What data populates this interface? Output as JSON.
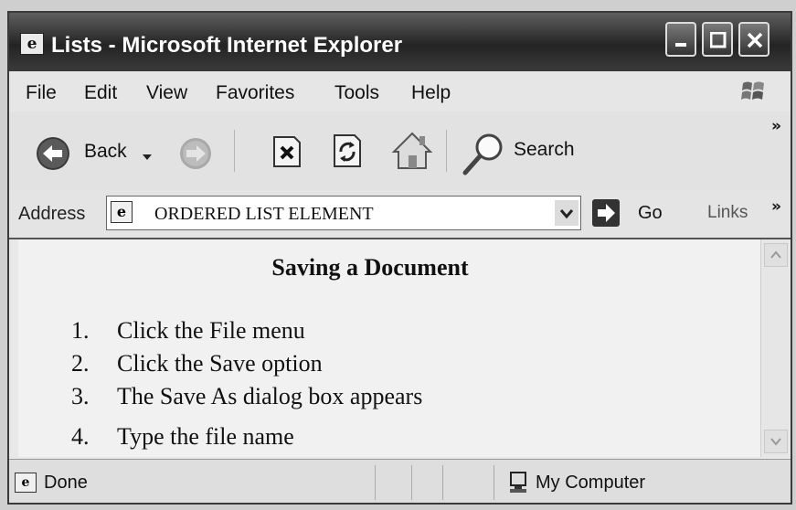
{
  "window": {
    "title": "Lists - Microsoft Internet Explorer"
  },
  "menu": {
    "items": [
      "File",
      "Edit",
      "View",
      "Favorites",
      "Tools",
      "Help"
    ]
  },
  "toolbar": {
    "back_label": "Back",
    "search_label": "Search",
    "overflow": "»"
  },
  "address": {
    "label": "Address",
    "value": "ORDERED LIST ELEMENT",
    "go_label": "Go",
    "links_label": "Links",
    "overflow": "»"
  },
  "document": {
    "heading": "Saving a Document",
    "list_items": [
      {
        "number": "1.",
        "text": "Click the File menu"
      },
      {
        "number": "2.",
        "text": "Click the Save option"
      },
      {
        "number": "3.",
        "text": "The Save As dialog box appears"
      },
      {
        "number": "4.",
        "text": "Type the file name"
      }
    ]
  },
  "status": {
    "text": "Done",
    "zone": "My Computer"
  },
  "colors": {
    "titlebar": "#2b2b2b",
    "content_bg": "#f1f1f1"
  },
  "icons": [
    "ie-page-icon",
    "minimize-icon",
    "maximize-icon",
    "close-icon",
    "windows-logo-icon",
    "back-arrow-icon",
    "forward-arrow-icon",
    "stop-icon",
    "refresh-icon",
    "home-icon",
    "search-icon",
    "go-arrow-icon",
    "my-computer-icon"
  ]
}
